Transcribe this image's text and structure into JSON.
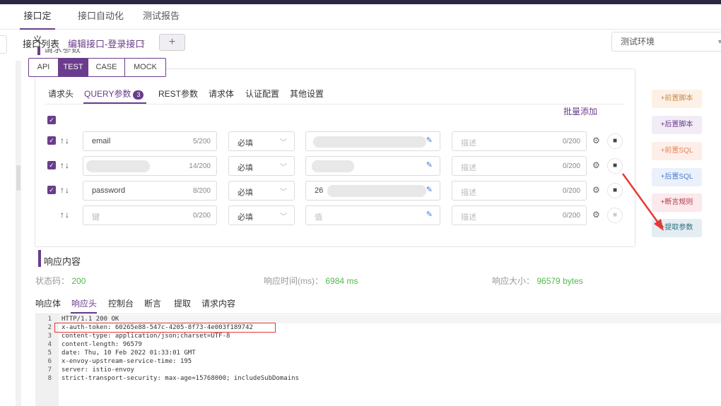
{
  "main_nav": [
    "接口定义",
    "接口自动化",
    "测试报告"
  ],
  "sub_tabs": {
    "list": "接口列表",
    "edit": "编辑接口-登录接口",
    "close": "×",
    "add": "+"
  },
  "environment": {
    "value": "测试环境"
  },
  "request_params": {
    "title": "请求参数",
    "modes": [
      "API",
      "TEST",
      "CASE",
      "MOCK"
    ],
    "tabs": [
      "请求头",
      "QUERY参数",
      "REST参数",
      "请求体",
      "认证配置",
      "其他设置"
    ],
    "query_count": "3",
    "batch_add": "批量添加",
    "rows": [
      {
        "key": "email",
        "key_count": "5/200",
        "required": "必填",
        "value": "",
        "desc_placeholder": "描述",
        "desc_count": "0/200"
      },
      {
        "key": "",
        "key_count": "14/200",
        "required": "必填",
        "value": "",
        "desc_placeholder": "描述",
        "desc_count": "0/200"
      },
      {
        "key": "password",
        "key_count": "8/200",
        "required": "必填",
        "value": "26",
        "desc_placeholder": "描述",
        "desc_count": "0/200"
      },
      {
        "key_placeholder": "键",
        "key_count": "0/200",
        "required": "必填",
        "value_placeholder": "值",
        "desc_placeholder": "描述",
        "desc_count": "0/200"
      }
    ]
  },
  "side_buttons": [
    "+前置脚本",
    "+后置脚本",
    "+前置SQL",
    "+后置SQL",
    "+断言规则",
    "+提取参数"
  ],
  "response": {
    "title": "响应内容",
    "status_label": "状态码：",
    "status": "200",
    "time_label": "响应时间(ms)：",
    "time": "6984 ms",
    "size_label": "响应大小：",
    "size": "96579 bytes",
    "tabs": [
      "响应体",
      "响应头",
      "控制台",
      "断言",
      "提取",
      "请求内容"
    ],
    "lines": [
      "HTTP/1.1 200 OK",
      "x-auth-token: 60265e88-547c-4205-8f73-4e003f189742",
      "content-type: application/json;charset=UTF-8",
      "content-length: 96579",
      "date: Thu, 10 Feb 2022 01:33:01 GMT",
      "x-envoy-upstream-service-time: 195",
      "server: istio-envoy",
      "strict-transport-security: max-age=15768000; includeSubDomains"
    ],
    "line_numbers": [
      "1",
      "2",
      "3",
      "4",
      "5",
      "6",
      "7",
      "8"
    ]
  },
  "colors": {
    "accent": "#6a3d8c",
    "success": "#52b84d",
    "highlight": "#e53935",
    "arrow": "#e53935"
  }
}
